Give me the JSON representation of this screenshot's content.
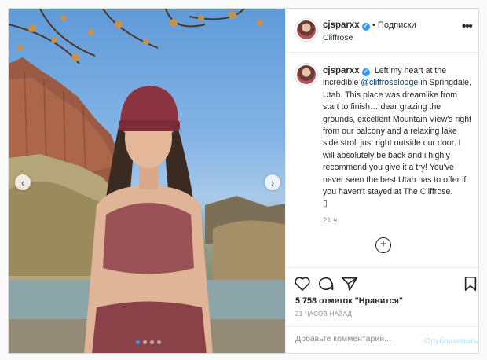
{
  "post": {
    "username": "cjsparxx",
    "follow_label": "• Подписки",
    "location": "Cliffrose",
    "more_label": "•••",
    "caption_text": "Left my heart at the incredible ",
    "mention": "@cliffroselodge",
    "caption_rest": " in Springdale, Utah. This place was dreamlike from start to finish… dear grazing the grounds, excellent Mountain View's right from our balcony and a relaxing lake side stroll just right outside our door. I will absolutely be back and i highly recommend you give it a try! You've never seen the best Utah has to offer if you haven't stayed at The Cliffrose.",
    "caption_emoji": "▯",
    "time_short": "21 ч.",
    "load_more": "+",
    "likes": "5 758 отметок \"Нравится\"",
    "time_ago": "21 ЧАСОВ НАЗАД",
    "comment_placeholder": "Добавьте комментарий...",
    "publish_label": "Опубликовать",
    "nav_prev": "‹",
    "nav_next": "›",
    "slide_count": 4,
    "active_slide": 0
  },
  "icons": {
    "like": "heart-icon",
    "comment": "comment-icon",
    "share": "paper-plane-icon",
    "save": "bookmark-icon",
    "verified": "verified-badge-icon"
  },
  "colors": {
    "accent": "#3897f0",
    "publish_disabled": "#b2dffc",
    "mention": "#00376b",
    "muted": "#8e8e8e"
  }
}
